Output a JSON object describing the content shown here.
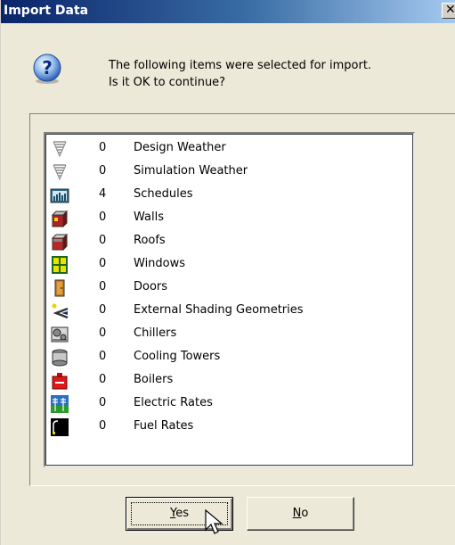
{
  "window": {
    "title": "Import Data",
    "close_glyph": "✕"
  },
  "message": {
    "line1": "The following items were selected for import.",
    "line2": "Is it OK to continue?",
    "icon": "help-question-icon"
  },
  "items": [
    {
      "count": "0",
      "label": "Design Weather",
      "icon": "design-weather-icon"
    },
    {
      "count": "0",
      "label": "Simulation Weather",
      "icon": "simulation-weather-icon"
    },
    {
      "count": "4",
      "label": "Schedules",
      "icon": "schedules-icon"
    },
    {
      "count": "0",
      "label": "Walls",
      "icon": "walls-icon"
    },
    {
      "count": "0",
      "label": "Roofs",
      "icon": "roofs-icon"
    },
    {
      "count": "0",
      "label": "Windows",
      "icon": "windows-icon"
    },
    {
      "count": "0",
      "label": "Doors",
      "icon": "doors-icon"
    },
    {
      "count": "0",
      "label": "External Shading Geometries",
      "icon": "shading-icon"
    },
    {
      "count": "0",
      "label": "Chillers",
      "icon": "chillers-icon"
    },
    {
      "count": "0",
      "label": "Cooling Towers",
      "icon": "cooling-towers-icon"
    },
    {
      "count": "0",
      "label": "Boilers",
      "icon": "boilers-icon"
    },
    {
      "count": "0",
      "label": "Electric Rates",
      "icon": "electric-rates-icon"
    },
    {
      "count": "0",
      "label": "Fuel Rates",
      "icon": "fuel-rates-icon"
    }
  ],
  "buttons": {
    "yes": {
      "mnemonic": "Y",
      "rest": "es"
    },
    "no": {
      "mnemonic": "N",
      "rest": "o"
    }
  },
  "colors": {
    "titlebar_start": "#0A246A",
    "titlebar_end": "#A6CAF0",
    "dialog_bg": "#ECE9D8"
  }
}
